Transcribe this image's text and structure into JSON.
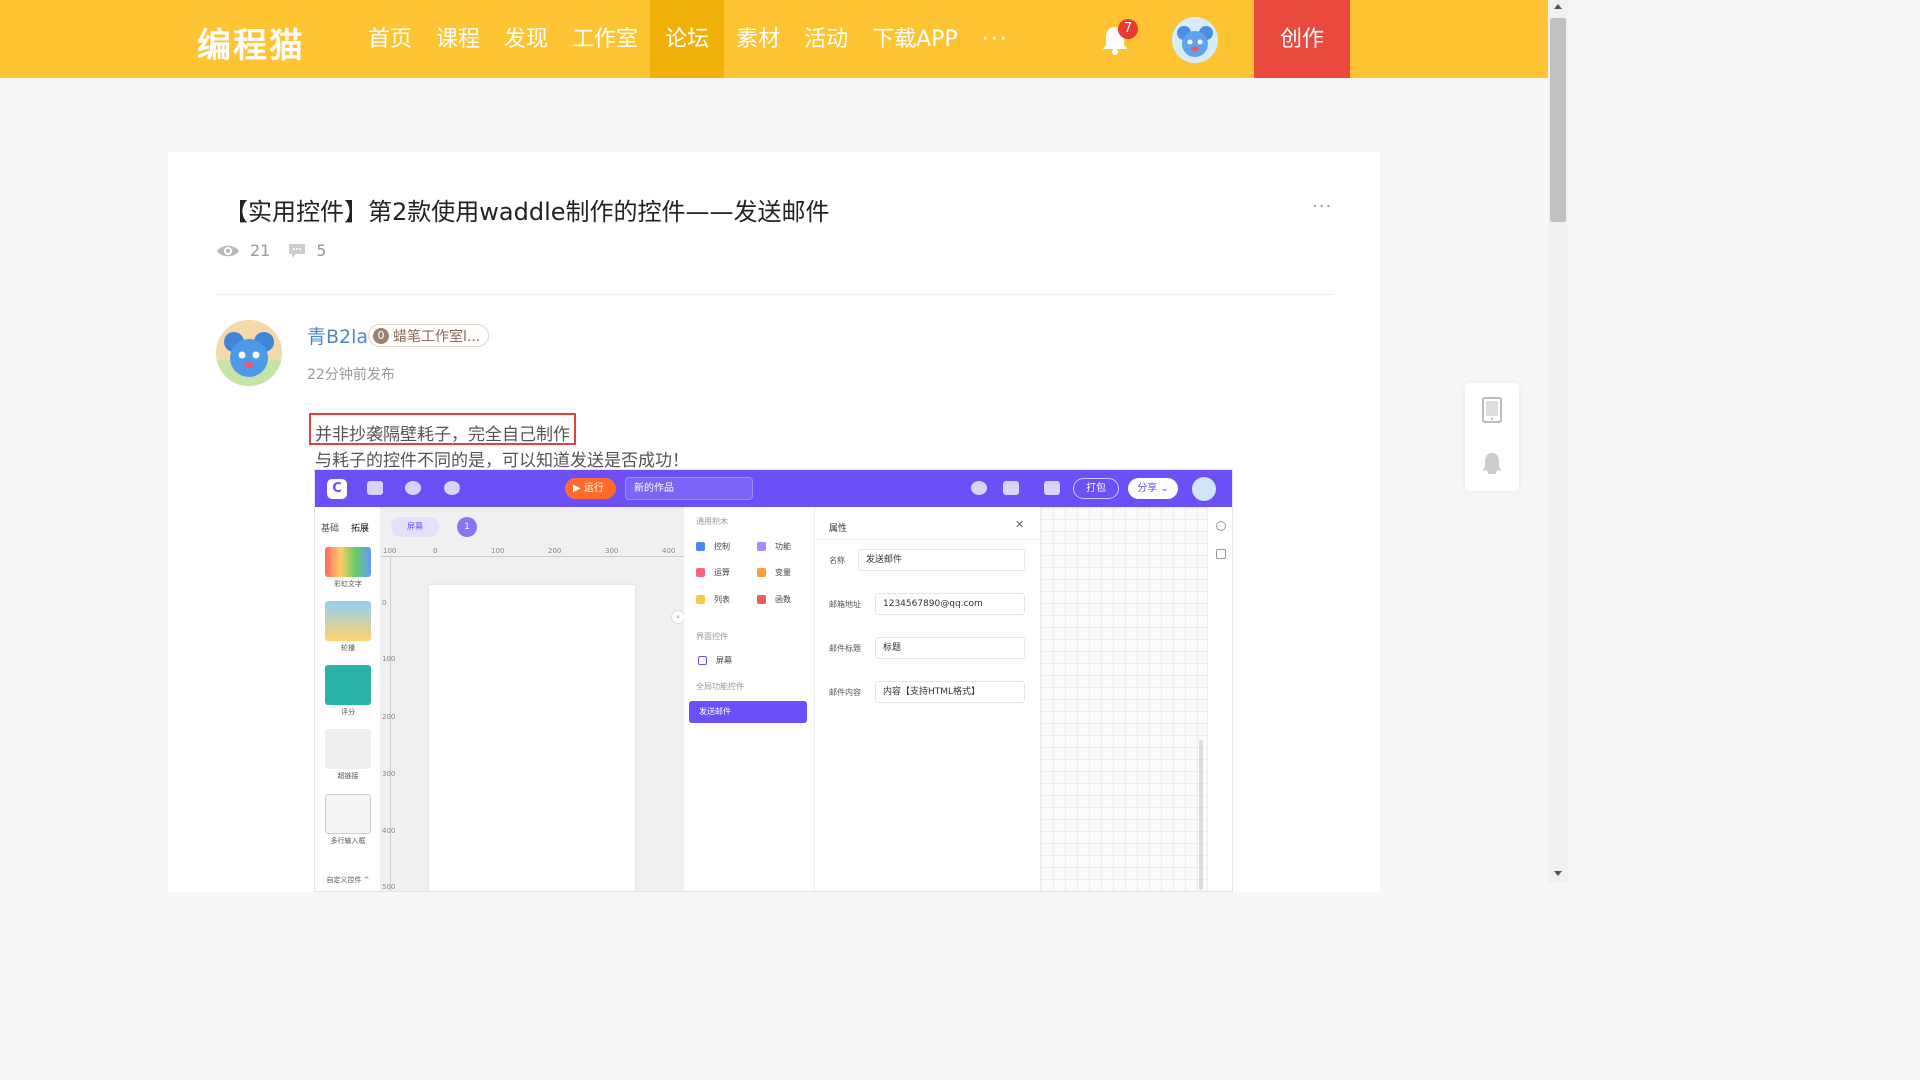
{
  "nav": {
    "logo": "编程猫",
    "items": [
      "首页",
      "课程",
      "发现",
      "工作室",
      "论坛",
      "素材",
      "活动",
      "下载APP"
    ],
    "active_index": 4,
    "more": "···",
    "notification_count": "7",
    "create_label": "创作"
  },
  "post": {
    "title": "【实用控件】第2款使用waddle制作的控件——发送邮件",
    "more": "···",
    "views": "21",
    "comments": "5",
    "author": "青B2la",
    "studio_level": "0",
    "studio": "蜡笔工作室l...",
    "time": "22分钟前发布",
    "line1": "并非抄袭隔壁耗子，完全自己制作",
    "line2": "与耗子的控件不同的是，可以知道发送是否成功！"
  },
  "screenshot": {
    "logo": "C",
    "run": "▶ 运行",
    "work_name": "新的作品",
    "pack": "打包",
    "share": "分享 ⌄",
    "left_tabs": [
      "基础",
      "拓展"
    ],
    "left_items": [
      "彩虹文字",
      "轮播",
      "评分",
      "超链接",
      "多行输入框"
    ],
    "left_footer": "自定义控件 ^",
    "screen_chip": "屏幕",
    "page_number": "1",
    "ruler_h": [
      "100",
      "0",
      "100",
      "200",
      "300",
      "400"
    ],
    "ruler_v": [
      "0",
      "100",
      "200",
      "300",
      "400",
      "500"
    ],
    "collapse": "«",
    "blocks_header": "通用积木",
    "blocks": [
      "控制",
      "功能",
      "运算",
      "变量",
      "列表",
      "函数"
    ],
    "ui_header": "界面控件",
    "ui_item": "屏幕",
    "global_header": "全局功能控件",
    "selected_block": "发送邮件",
    "props_title": "属性",
    "props_close": "✕",
    "props": [
      {
        "label": "名称",
        "value": "发送邮件"
      },
      {
        "label": "邮箱地址",
        "value": "1234567890@qq.com"
      },
      {
        "label": "邮件标题",
        "value": "标题"
      },
      {
        "label": "邮件内容",
        "value": "内容【支持HTML格式】"
      }
    ]
  },
  "colors": {
    "nav_bg": "#fec433",
    "nav_active": "#f2b10a",
    "create_bg": "#ea4a3d",
    "link": "#4c88c9",
    "highlight_border": "#e8413b",
    "editor_purple": "#6c4ff6"
  }
}
